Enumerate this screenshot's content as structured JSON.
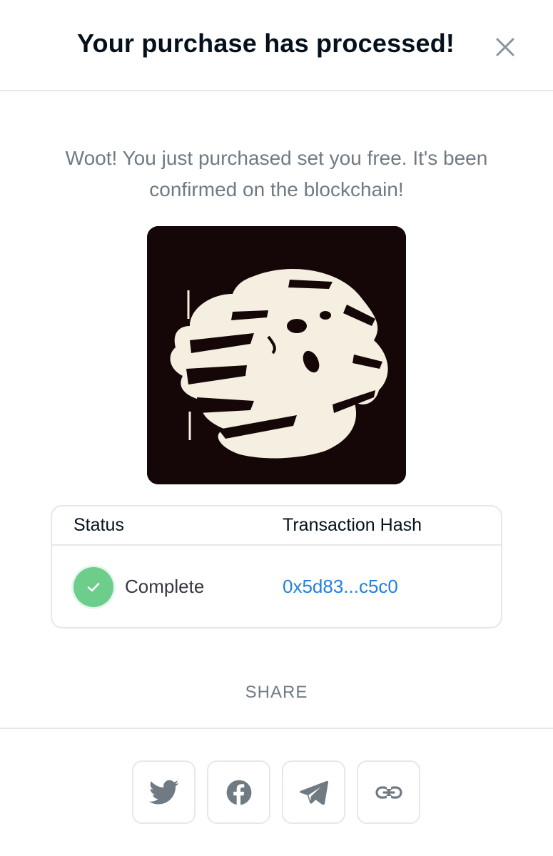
{
  "header": {
    "title": "Your purchase has processed!",
    "close_icon": "close-icon"
  },
  "message": "Woot! You just purchased set you free. It's been confirmed on the blockchain!",
  "artwork": {
    "description_icon": "nft-artwork-image"
  },
  "transaction": {
    "headers": [
      "Status",
      "Transaction Hash"
    ],
    "status": "Complete",
    "status_icon": "check-icon",
    "status_color": "#6dce8c",
    "hash": "0x5d83...c5c0",
    "hash_color": "#2081e2"
  },
  "share": {
    "label": "SHARE",
    "buttons": [
      "twitter-icon",
      "facebook-icon",
      "telegram-icon",
      "link-icon"
    ]
  }
}
